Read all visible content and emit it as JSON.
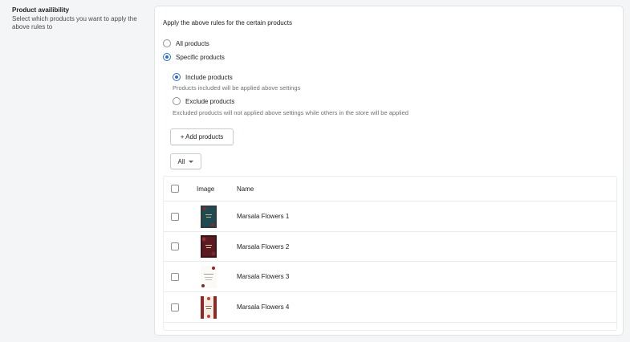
{
  "section": {
    "title": "Product availibility",
    "description": "Select which products you want to apply the above rules to"
  },
  "card": {
    "intro": "Apply the above rules for the certain products",
    "scope_options": [
      {
        "label": "All products",
        "checked": false
      },
      {
        "label": "Specific products",
        "checked": true
      }
    ],
    "include": {
      "label": "Include products",
      "help": "Products included will be applied above settings",
      "checked": true
    },
    "exclude": {
      "label": "Exclude products",
      "help": "Excluded products will not applied above settings while others in the store will be applied",
      "checked": false
    },
    "add_button": "+ Add products",
    "filter": {
      "selected": "All"
    }
  },
  "table": {
    "headers": {
      "image": "Image",
      "name": "Name"
    },
    "rows": [
      {
        "name": "Marsala Flowers 1",
        "thumb": "dark-teal"
      },
      {
        "name": "Marsala Flowers 2",
        "thumb": "dark-red"
      },
      {
        "name": "Marsala Flowers 3",
        "thumb": "white-card"
      },
      {
        "name": "Marsala Flowers 4",
        "thumb": "floral-frame"
      }
    ]
  },
  "colors": {
    "accent": "#2c6ecb",
    "border": "#e1e3e5"
  }
}
